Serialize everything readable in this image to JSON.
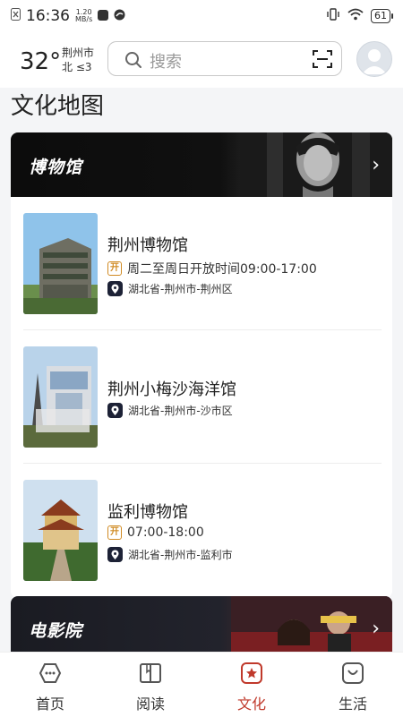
{
  "status_bar": {
    "time": "16:36",
    "net_speed_value": "1.20",
    "net_speed_unit": "MB/s",
    "battery": "61"
  },
  "weather": {
    "temperature": "32°",
    "city": "荆州市",
    "wind": "北 ≤3"
  },
  "search": {
    "placeholder": "搜索"
  },
  "page_title": "文化地图",
  "museums": {
    "banner_title": "博物馆",
    "items": [
      {
        "name": "荆州博物馆",
        "hours": "周二至周日开放时间09:00-17:00",
        "address": "湖北省-荆州市-荆州区"
      },
      {
        "name": "荆州小梅沙海洋馆",
        "hours": "",
        "address": "湖北省-荆州市-沙市区"
      },
      {
        "name": "监利博物馆",
        "hours": "07:00-18:00",
        "address": "湖北省-荆州市-监利市"
      }
    ],
    "open_badge": "开"
  },
  "cinema": {
    "banner_title": "电影院"
  },
  "bottom_nav": {
    "items": [
      {
        "label": "首页",
        "icon": "home-icon"
      },
      {
        "label": "阅读",
        "icon": "book-icon"
      },
      {
        "label": "文化",
        "icon": "culture-icon",
        "active": true
      },
      {
        "label": "生活",
        "icon": "life-icon"
      }
    ]
  },
  "colors": {
    "accent": "#c0392b",
    "badge": "#d08a22"
  }
}
